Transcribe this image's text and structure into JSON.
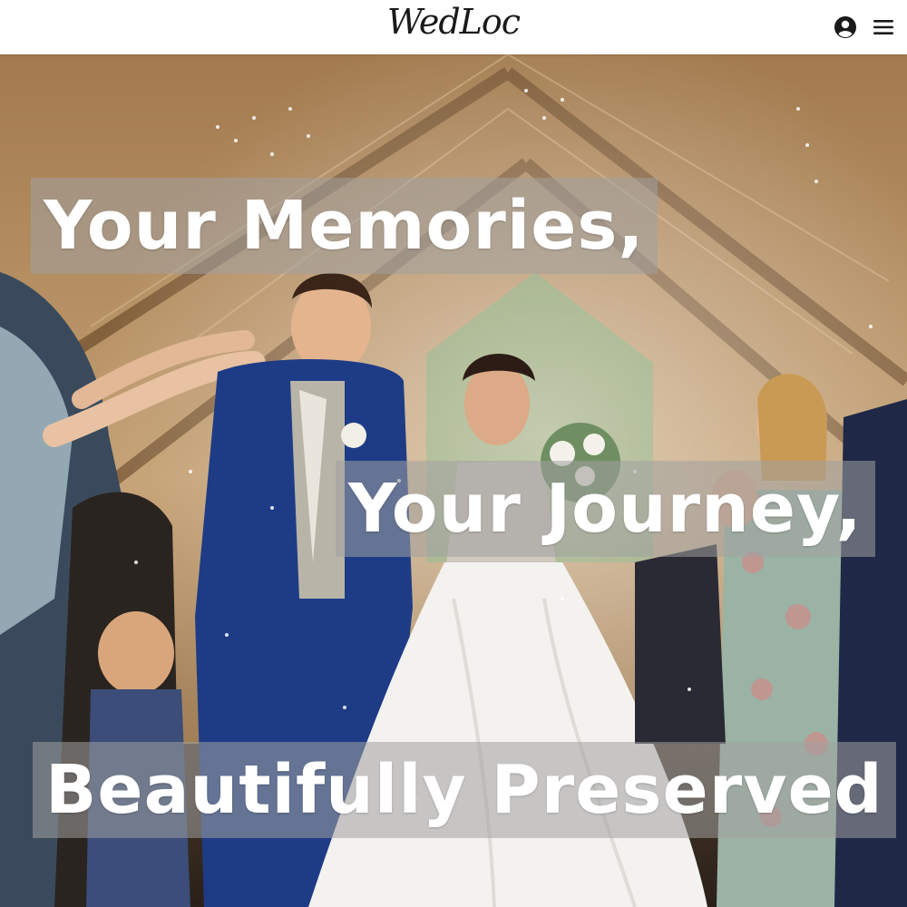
{
  "header": {
    "logo_text": "WedLoc",
    "account_icon": "account-circle-icon",
    "menu_icon": "hamburger-menu-icon"
  },
  "hero": {
    "line1": "Your Memories,",
    "line2": "Your Journey,",
    "line3": "Beautifully Preserved"
  },
  "colors": {
    "header_bg": "#ffffff",
    "icon": "#1a1a1a",
    "headline_text": "#ffffff",
    "headline_bg": "rgba(160,160,160,0.55)"
  }
}
